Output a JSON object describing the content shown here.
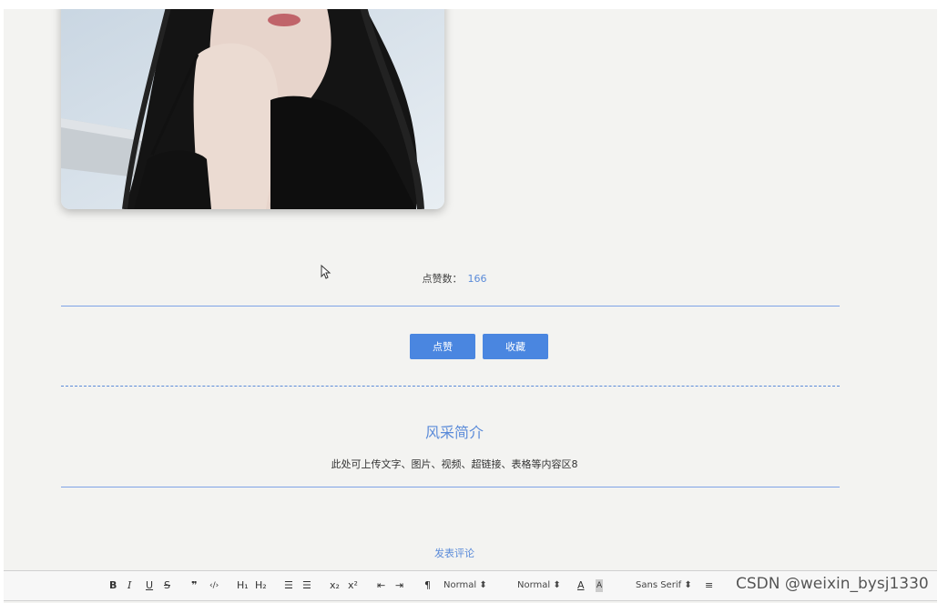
{
  "likes": {
    "label": "点赞数：",
    "count": "166"
  },
  "actions": {
    "like_label": "点赞",
    "favorite_label": "收藏"
  },
  "intro": {
    "title": "风采简介",
    "body": "此处可上传文字、图片、视频、超链接、表格等内容区8"
  },
  "comment": {
    "link_label": "发表评论"
  },
  "toolbar": {
    "bold": "B",
    "italic": "I",
    "underline": "U",
    "strike": "S",
    "blockquote": "❞",
    "code": "‹/›",
    "h1": "H₁",
    "h2": "H₂",
    "ordered_list": "☰",
    "bullet_list": "☰",
    "subscript": "x₂",
    "superscript": "x²",
    "outdent": "⇤",
    "indent": "⇥",
    "direction": "¶",
    "size_select": "Normal",
    "header_select": "Normal",
    "font_color": "A",
    "background_color": "A",
    "font_select": "Sans Serif",
    "align": "≡"
  },
  "watermark": "CSDN @weixin_bysj1330",
  "colors": {
    "accent": "#4a86e0",
    "link": "#5b8bd9",
    "divider": "#7ea3e6"
  }
}
